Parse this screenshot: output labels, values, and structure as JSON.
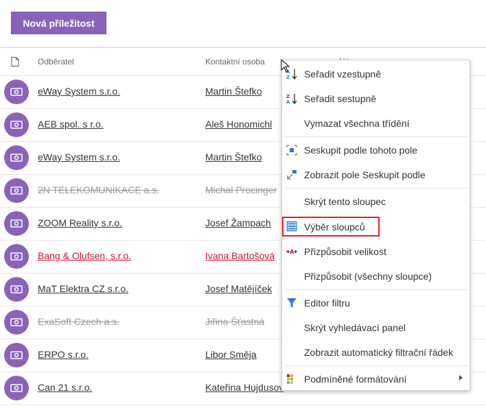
{
  "toolbar": {
    "new_opportunity_label": "Nová příležitost"
  },
  "grid": {
    "columns": [
      {
        "label": "Odběratel"
      },
      {
        "label": "Kontaktní osoba"
      },
      {
        "label": "Ná"
      }
    ],
    "rows": [
      {
        "customer": "eWay System s.r.o.",
        "contact": "Martin Štefko",
        "state": "normal"
      },
      {
        "customer": "AEB spol. s r.o.",
        "contact": "Aleš Honomichl",
        "state": "normal"
      },
      {
        "customer": "eWay System s.r.o.",
        "contact": "Martin Štefko",
        "state": "normal"
      },
      {
        "customer": "2N TELEKOMUNIKACE a.s.",
        "contact": "Michal Procinger",
        "state": "strike"
      },
      {
        "customer": "ZOOM Reality s.r.o.",
        "contact": "Josef Žampach",
        "state": "normal"
      },
      {
        "customer": "Bang & Olufsen, s.r.o.",
        "contact": "Ivana Bartošová",
        "state": "red"
      },
      {
        "customer": "MaT Elektra CZ s.r.o.",
        "contact": "Josef Matějíček",
        "state": "normal"
      },
      {
        "customer": "ExaSoft Czech a.s.",
        "contact": "Jiřina Šťastná",
        "state": "strike"
      },
      {
        "customer": "ERPO s.r.o.",
        "contact": "Libor Směja",
        "state": "normal"
      },
      {
        "customer": "Can 21 s.r.o.",
        "contact": "Kateřina Hujdusov",
        "state": "normal"
      }
    ]
  },
  "context_menu": {
    "items": [
      {
        "label": "Seřadit vzestupně",
        "icon": "sort-ascending-icon"
      },
      {
        "label": "Seřadit sestupně",
        "icon": "sort-descending-icon"
      },
      {
        "label": "Vymazat všechna třídění",
        "icon": ""
      },
      {
        "label": "Seskupit podle tohoto pole",
        "icon": "group-by-field-icon"
      },
      {
        "label": "Zobrazit pole Seskupit podle",
        "icon": "show-group-panel-icon"
      },
      {
        "label": "Skrýt tento sloupec",
        "icon": ""
      },
      {
        "label": "Výběr sloupců",
        "icon": "column-chooser-icon",
        "highlighted": true
      },
      {
        "label": "Přizpůsobit velikost",
        "icon": "best-fit-icon"
      },
      {
        "label": "Přizpůsobit (všechny sloupce)",
        "icon": ""
      },
      {
        "label": "Editor filtru",
        "icon": "filter-icon"
      },
      {
        "label": "Skrýt vyhledávací panel",
        "icon": ""
      },
      {
        "label": "Zobrazit automatický filtrační řádek",
        "icon": ""
      },
      {
        "label": "Podmíněné formátování",
        "icon": "conditional-formatting-icon",
        "has_submenu": true
      }
    ]
  },
  "colors": {
    "accent": "#8b62b9",
    "highlight_border": "#e0202b",
    "overdue_text": "#d0112b"
  }
}
